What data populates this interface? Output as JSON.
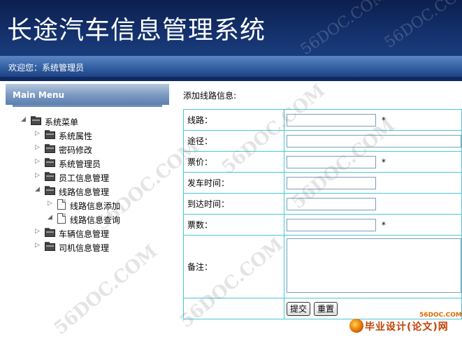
{
  "header": {
    "title": "长途汽车信息管理系统",
    "watermark": "56DOC.COM"
  },
  "welcome": {
    "text": "欢迎您：系统管理员"
  },
  "menu": {
    "title": "Main Menu",
    "root": "系统菜单",
    "items": [
      {
        "label": "系统属性"
      },
      {
        "label": "密码修改"
      },
      {
        "label": "系统管理员"
      },
      {
        "label": "员工信息管理"
      },
      {
        "label": "线路信息管理"
      },
      {
        "label": "线路信息添加"
      },
      {
        "label": "线路信息查询"
      },
      {
        "label": "车辆信息管理"
      },
      {
        "label": "司机信息管理"
      }
    ]
  },
  "form": {
    "title": "添加线路信息:",
    "fields": {
      "route": {
        "label": "线路：",
        "value": ""
      },
      "via": {
        "label": "途径：",
        "value": ""
      },
      "price": {
        "label": "票价：",
        "value": ""
      },
      "depart": {
        "label": "发车时间：",
        "value": ""
      },
      "arrive": {
        "label": "到达时间：",
        "value": ""
      },
      "tickets": {
        "label": "票数：",
        "value": ""
      },
      "remark": {
        "label": "备注：",
        "value": ""
      }
    },
    "required_mark": "*",
    "submit_label": "提交",
    "reset_label": "重置",
    "border_color": "#49c7d6"
  },
  "watermark": {
    "text": "56DOC.COM"
  },
  "logo": {
    "site": "56DOC.COM",
    "text": "毕业设计(论文)网"
  },
  "colors": {
    "header_bg": "#13306b",
    "welcome_bar": "#3a67a8"
  }
}
